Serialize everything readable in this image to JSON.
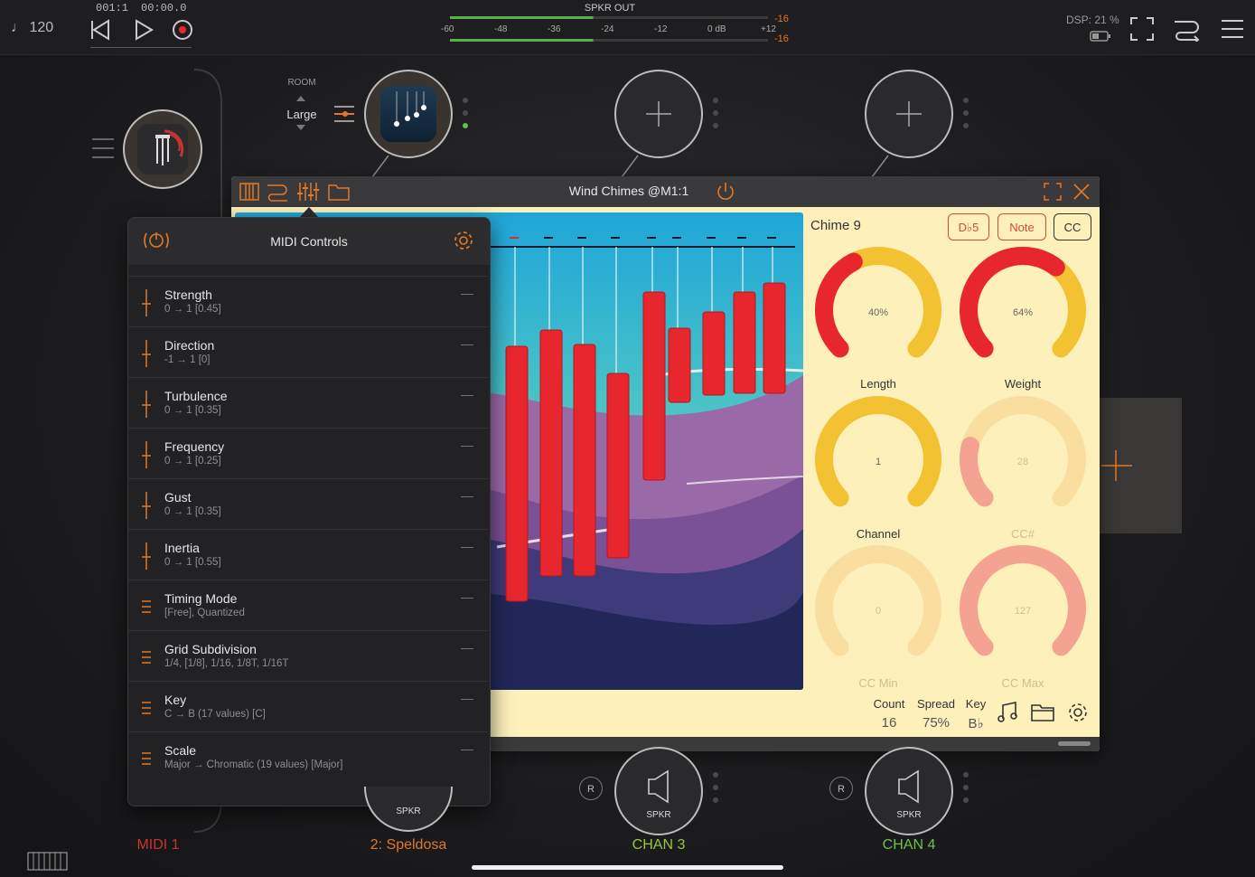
{
  "topbar": {
    "tempo": "♩ 120",
    "position": "001:1",
    "time": "00:00.0",
    "meter_title": "SPKR OUT",
    "meter_scale": [
      "-60",
      "-48",
      "-36",
      "-24",
      "-12",
      "0 dB",
      "+12"
    ],
    "meter_peak_top": "-16",
    "meter_peak_bottom": "-16",
    "dsp": "DSP: 21 %"
  },
  "room": {
    "label": "ROOM",
    "value": "Large"
  },
  "plugin": {
    "title": "Wind Chimes @M1:1",
    "chime_title": "Chime 9",
    "buttons": {
      "note_name": "D♭5",
      "note": "Note",
      "cc": "CC"
    },
    "knobs": [
      {
        "label": "Length",
        "value": "40%",
        "fraction": 0.4
      },
      {
        "label": "Weight",
        "value": "64%",
        "fraction": 0.64
      },
      {
        "label": "Channel",
        "value": "1",
        "fraction": 0.0
      },
      {
        "label": "CC#",
        "value": "28",
        "fraction": 0.22
      },
      {
        "label": "CC Min",
        "value": "0",
        "fraction": 0.0
      },
      {
        "label": "CC Max",
        "value": "127",
        "fraction": 1.0
      }
    ],
    "footer": {
      "count_label": "Count",
      "count_value": "16",
      "spread_label": "Spread",
      "spread_value": "75%",
      "key_label": "Key",
      "key_value": "B♭"
    }
  },
  "midi": {
    "title": "MIDI Controls",
    "rows": [
      {
        "name": "Strength",
        "range": "0 → 1  [0.45]",
        "kind": "slider"
      },
      {
        "name": "Direction",
        "range": "-1 → 1  [0]",
        "kind": "slider"
      },
      {
        "name": "Turbulence",
        "range": "0 → 1  [0.35]",
        "kind": "slider"
      },
      {
        "name": "Frequency",
        "range": "0 → 1  [0.25]",
        "kind": "slider"
      },
      {
        "name": "Gust",
        "range": "0 → 1  [0.35]",
        "kind": "slider"
      },
      {
        "name": "Inertia",
        "range": "0 → 1  [0.55]",
        "kind": "slider"
      },
      {
        "name": "Timing Mode",
        "range": "[Free], Quantized",
        "kind": "list"
      },
      {
        "name": "Grid Subdivision",
        "range": "1/4, [1/8], 1/16, 1/8T, 1/16T",
        "kind": "list"
      },
      {
        "name": "Key",
        "range": "C → B (17 values) [C]",
        "kind": "list"
      },
      {
        "name": "Scale",
        "range": "Major → Chromatic (19 values) [Major]",
        "kind": "list"
      }
    ],
    "dash": "—"
  },
  "nodes": {
    "spkr": "SPKR",
    "r": "R"
  },
  "channels": {
    "midi1": "MIDI 1",
    "speldosa": "2: Speldosa",
    "chan3": "CHAN 3",
    "chan4": "CHAN 4"
  },
  "colors": {
    "accent": "#e07828",
    "red": "#e8262e",
    "yellow": "#f2c232",
    "green": "#7ec64a"
  }
}
